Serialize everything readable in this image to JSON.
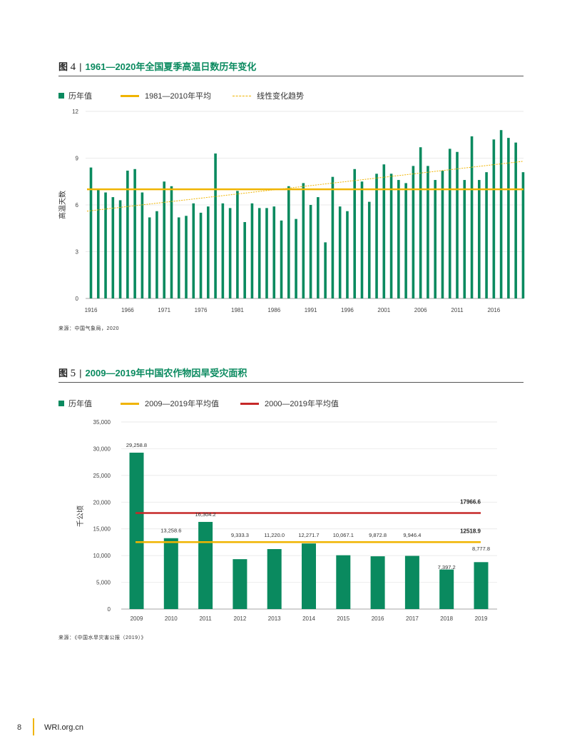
{
  "fig4": {
    "label": "图",
    "number": "4",
    "title": "1961—2020年全国夏季高温日数历年变化",
    "legend": {
      "bars": "历年值",
      "avg": "1981—2010年平均",
      "trend": "线性变化趋势"
    },
    "source": "来源：中国气象局，2020"
  },
  "fig5": {
    "label": "图",
    "number": "5",
    "title": "2009—2019年中国农作物因旱受灾面积",
    "legend": {
      "bars": "历年值",
      "avg1": "2009—2019年平均值",
      "avg2": "2000—2019年平均值"
    },
    "source": "来源：《中国水旱灾害公报（2019）》"
  },
  "footer": {
    "page": "8",
    "url": "WRI.org.cn"
  },
  "chart_data": [
    {
      "type": "bar",
      "ylabel": "高温天数",
      "ylim": [
        0,
        12
      ],
      "yticks": [
        "0",
        "3",
        "6",
        "9",
        "12"
      ],
      "xtick_labels": [
        "1916",
        "1966",
        "1971",
        "1976",
        "1981",
        "1986",
        "1991",
        "1996",
        "2001",
        "2006",
        "2011",
        "2016"
      ],
      "series": [
        {
          "name": "历年值",
          "values": [
            8.4,
            7.0,
            6.8,
            6.5,
            6.3,
            8.2,
            8.3,
            6.8,
            5.2,
            5.6,
            7.5,
            7.2,
            5.2,
            5.3,
            6.1,
            5.5,
            5.9,
            9.3,
            6.1,
            5.8,
            6.9,
            4.9,
            6.1,
            5.8,
            5.8,
            5.9,
            5.0,
            7.2,
            5.1,
            7.4,
            6.0,
            6.5,
            3.6,
            7.8,
            5.9,
            5.6,
            8.3,
            7.5,
            6.2,
            8.0,
            8.6,
            8.0,
            7.6,
            7.4,
            8.5,
            9.7,
            8.5,
            7.6,
            8.2,
            9.6,
            9.4,
            7.6,
            10.4,
            7.6,
            8.1,
            10.2,
            10.8,
            10.3,
            10.0,
            8.1
          ]
        }
      ],
      "average_value": 7.0,
      "trend": [
        5.6,
        8.8
      ],
      "colors": {
        "bar": "#0a8a5f",
        "avg": "#f0b400",
        "trend": "#f0b400"
      }
    },
    {
      "type": "bar",
      "ylabel": "千公顷",
      "ylim": [
        0,
        35000
      ],
      "yticks": [
        "0",
        "5,000",
        "10,000",
        "15,000",
        "20,000",
        "25,000",
        "30,000",
        "35,000"
      ],
      "categories": [
        "2009",
        "2010",
        "2011",
        "2012",
        "2013",
        "2014",
        "2015",
        "2016",
        "2017",
        "2018",
        "2019"
      ],
      "series": [
        {
          "name": "历年值",
          "values": [
            29258.8,
            13258.6,
            16304.2,
            9333.3,
            11220.0,
            12271.7,
            10067.1,
            9872.8,
            9946.4,
            7397.2,
            8777.8
          ],
          "labels": [
            "29,258.8",
            "13,258.6",
            "16,304.2",
            "9,333.3",
            "11,220.0",
            "12,271.7",
            "10,067.1",
            "9,872.8",
            "9,946.4",
            "7,397.2",
            "8,777.8"
          ]
        }
      ],
      "avg_2009_2019": 12518.9,
      "avg_2009_2019_label": "12518.9",
      "avg_2000_2019": 17966.6,
      "avg_2000_2019_label": "17966.6",
      "colors": {
        "bar": "#0a8a5f",
        "avg1": "#f0b400",
        "avg2": "#c62828"
      }
    }
  ]
}
